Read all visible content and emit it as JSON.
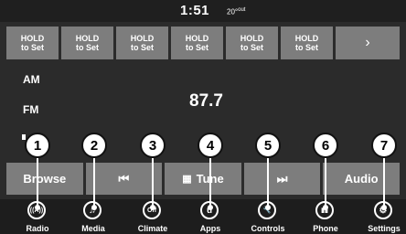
{
  "status": {
    "time": "1:51",
    "temp": "20°",
    "temp_suffix": "out"
  },
  "presets": [
    {
      "line1": "HOLD",
      "line2": "to Set"
    },
    {
      "line1": "HOLD",
      "line2": "to Set"
    },
    {
      "line1": "HOLD",
      "line2": "to Set"
    },
    {
      "line1": "HOLD",
      "line2": "to Set"
    },
    {
      "line1": "HOLD",
      "line2": "to Set"
    },
    {
      "line1": "HOLD",
      "line2": "to Set"
    }
  ],
  "presets_next": "›",
  "bands": {
    "am": "AM",
    "fm": "FM"
  },
  "frequency": "87.7",
  "controls": {
    "browse": "Browse",
    "seek_back": "⏮",
    "tune_icon": "▦",
    "tune": "Tune",
    "seek_forward": "⏭",
    "audio": "Audio"
  },
  "nav": [
    {
      "label": "Radio",
      "icon": "radio-antenna-icon",
      "glyph": "((A))"
    },
    {
      "label": "Media",
      "icon": "music-note-icon",
      "glyph": "♫"
    },
    {
      "label": "Climate",
      "icon": "climate-off-icon",
      "glyph": "Off"
    },
    {
      "label": "Apps",
      "icon": "apps-icon",
      "glyph": "û"
    },
    {
      "label": "Controls",
      "icon": "wrench-icon",
      "glyph": "🔧"
    },
    {
      "label": "Phone",
      "icon": "phone-signal-icon",
      "glyph": "▮▮"
    },
    {
      "label": "Settings",
      "icon": "gear-icon",
      "glyph": "⚙"
    }
  ],
  "callouts": [
    "1",
    "2",
    "3",
    "4",
    "5",
    "6",
    "7"
  ],
  "colors": {
    "button_gray": "#7d7d7d",
    "background": "#2b2b2b",
    "bar": "#1d1d1d"
  }
}
